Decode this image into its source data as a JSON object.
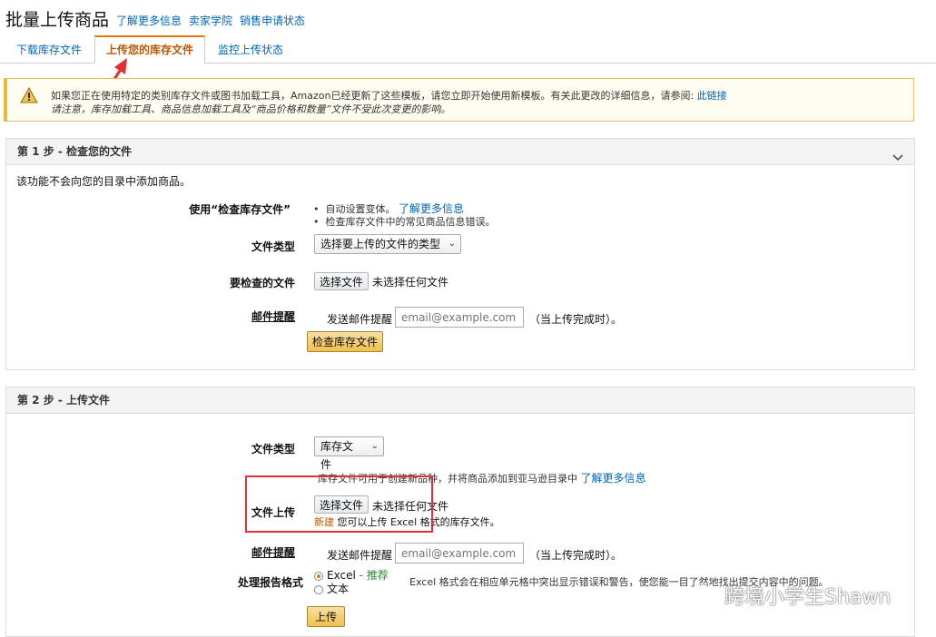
{
  "header": {
    "title": "批量上传商品",
    "links": [
      "了解更多信息",
      "卖家学院",
      "销售申请状态"
    ]
  },
  "tabs": [
    {
      "label": "下载库存文件"
    },
    {
      "label": "上传您的库存文件"
    },
    {
      "label": "监控上传状态"
    }
  ],
  "alert": {
    "line1": "如果您正在使用特定的类别库存文件或图书加载工具，Amazon已经更新了这些模板，请您立即开始使用新模板。有关此更改的详细信息，请参阅:",
    "link": "此链接",
    "line2": "请注意，库存加载工具、商品信息加载工具及“商品价格和数量”文件不受此次变更的影响。"
  },
  "step1": {
    "header": "第 1 步 - 检查您的文件",
    "intro": "该功能不会向您的目录中添加商品。",
    "use_label": "使用“检查库存文件”",
    "bullet1": "自动设置变体。",
    "bullet1_link": "了解更多信息",
    "bullet2": "检查库存文件中的常见商品信息错误。",
    "file_type_label": "文件类型",
    "file_type_value": "选择要上传的文件的类型",
    "check_file_label": "要检查的文件",
    "choose_file": "选择文件",
    "no_file": "未选择任何文件",
    "email_label": "邮件提醒",
    "email_text": "发送邮件提醒",
    "email_placeholder": "email@example.com",
    "email_suffix": "（当上传完成时）。",
    "check_button": "检查库存文件"
  },
  "step2": {
    "header": "第 2 步 - 上传文件",
    "file_type_label": "文件类型",
    "file_type_value": "库存文件",
    "help_text": "库存文件可用于创建新品种，并将商品添加到亚马逊目录中",
    "help_link": "了解更多信息",
    "upload_label": "文件上传",
    "choose_file": "选择文件",
    "no_file": "未选择任何文件",
    "new_badge": "新建",
    "excel_note": "您可以上传 Excel 格式的库存文件。",
    "email_label": "邮件提醒",
    "email_text": "发送邮件提醒",
    "email_placeholder": "email@example.com",
    "email_suffix": "（当上传完成时）。",
    "report_label": "处理报告格式",
    "opt_excel": "Excel",
    "opt_recommend": "- 推荐",
    "opt_text": "文本",
    "excel_desc": "Excel 格式会在相应单元格中突出显示错误和警告，使您能一目了然地找出提交内容中的问题。",
    "upload_button": "上传"
  },
  "watermark": "跨境小学生Shawn",
  "colors": {
    "accent": "#e47911",
    "link": "#0066c0",
    "annotation": "#e03030"
  }
}
